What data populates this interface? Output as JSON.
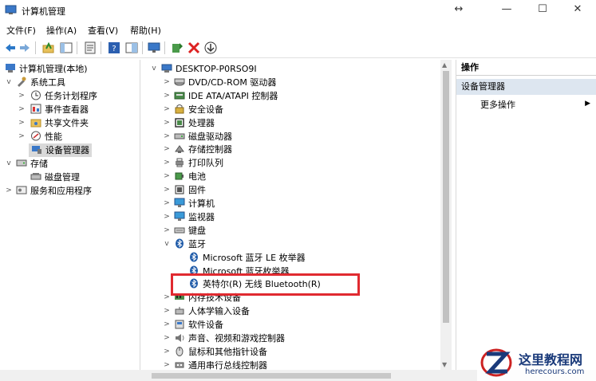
{
  "window": {
    "title": "计算机管理",
    "controls": [
      "↔",
      "—",
      "☐",
      "✕"
    ]
  },
  "menu": [
    "文件(F)",
    "操作(A)",
    "查看(V)",
    "帮助(H)"
  ],
  "left_tree": [
    {
      "label": "计算机管理(本地)",
      "level": 0,
      "expander": ""
    },
    {
      "label": "系统工具",
      "level": 1,
      "expander": "v"
    },
    {
      "label": "任务计划程序",
      "level": 2,
      "expander": ">"
    },
    {
      "label": "事件查看器",
      "level": 2,
      "expander": ">"
    },
    {
      "label": "共享文件夹",
      "level": 2,
      "expander": ">"
    },
    {
      "label": "性能",
      "level": 2,
      "expander": ">"
    },
    {
      "label": "设备管理器",
      "level": 2,
      "expander": "",
      "selected": true
    },
    {
      "label": "存储",
      "level": 1,
      "expander": "v"
    },
    {
      "label": "磁盘管理",
      "level": 2,
      "expander": ""
    },
    {
      "label": "服务和应用程序",
      "level": 1,
      "expander": ">"
    }
  ],
  "device_tree": [
    {
      "label": "DESKTOP-P0RSO9I",
      "level": 0,
      "expander": "v",
      "icon": "computer-icon"
    },
    {
      "label": "DVD/CD-ROM 驱动器",
      "level": 1,
      "expander": ">",
      "icon": "dvd-icon"
    },
    {
      "label": "IDE ATA/ATAPI 控制器",
      "level": 1,
      "expander": ">",
      "icon": "ide-icon"
    },
    {
      "label": "安全设备",
      "level": 1,
      "expander": ">",
      "icon": "security-icon"
    },
    {
      "label": "处理器",
      "level": 1,
      "expander": ">",
      "icon": "cpu-icon"
    },
    {
      "label": "磁盘驱动器",
      "level": 1,
      "expander": ">",
      "icon": "disk-icon"
    },
    {
      "label": "存储控制器",
      "level": 1,
      "expander": ">",
      "icon": "storage-icon"
    },
    {
      "label": "打印队列",
      "level": 1,
      "expander": ">",
      "icon": "printer-icon"
    },
    {
      "label": "电池",
      "level": 1,
      "expander": ">",
      "icon": "battery-icon"
    },
    {
      "label": "固件",
      "level": 1,
      "expander": ">",
      "icon": "firmware-icon"
    },
    {
      "label": "计算机",
      "level": 1,
      "expander": ">",
      "icon": "monitor-icon"
    },
    {
      "label": "监视器",
      "level": 1,
      "expander": ">",
      "icon": "monitor-icon"
    },
    {
      "label": "键盘",
      "level": 1,
      "expander": ">",
      "icon": "keyboard-icon"
    },
    {
      "label": "蓝牙",
      "level": 1,
      "expander": "v",
      "icon": "bluetooth-icon"
    },
    {
      "label": "Microsoft 蓝牙 LE 枚举器",
      "level": 2,
      "expander": "",
      "icon": "bluetooth-icon"
    },
    {
      "label": "Microsoft 蓝牙枚举器",
      "level": 2,
      "expander": "",
      "icon": "bluetooth-icon"
    },
    {
      "label": "英特尔(R) 无线 Bluetooth(R)",
      "level": 2,
      "expander": "",
      "icon": "bluetooth-icon"
    },
    {
      "label": "内存技术设备",
      "level": 1,
      "expander": ">",
      "icon": "memory-icon"
    },
    {
      "label": "人体学输入设备",
      "level": 1,
      "expander": ">",
      "icon": "hid-icon"
    },
    {
      "label": "软件设备",
      "level": 1,
      "expander": ">",
      "icon": "software-icon"
    },
    {
      "label": "声音、视频和游戏控制器",
      "level": 1,
      "expander": ">",
      "icon": "sound-icon"
    },
    {
      "label": "鼠标和其他指针设备",
      "level": 1,
      "expander": ">",
      "icon": "mouse-icon"
    },
    {
      "label": "通用串行总线控制器",
      "level": 1,
      "expander": ">",
      "icon": "usb-icon"
    }
  ],
  "actions": {
    "header": "操作",
    "selected": "设备管理器",
    "more": "更多操作"
  },
  "watermark": {
    "cn": "这里教程网",
    "en": "herecours.com"
  },
  "colors": {
    "highlight": "#e02a30",
    "bluetooth": "#1e5aa8",
    "selection": "#d9d9d9"
  }
}
